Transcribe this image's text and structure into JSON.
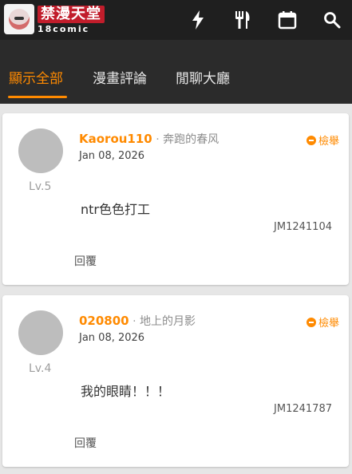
{
  "app": {
    "logo_title": "禁漫天堂",
    "logo_sub": "18comic",
    "icons": [
      "lightning-icon",
      "fork-knife-icon",
      "calendar-icon",
      "search-icon"
    ]
  },
  "tabs": [
    {
      "label": "顯示全部",
      "active": true
    },
    {
      "label": "漫畫評論",
      "active": false
    },
    {
      "label": "閒聊大廳",
      "active": false
    }
  ],
  "colors": {
    "accent": "#ff8a00",
    "topbar": "#1f1f1f",
    "tabbar": "#2b2b2b"
  },
  "comments": [
    {
      "username": "Kaorou110",
      "separator": "·",
      "subname": "奔跑的春风",
      "date": "Jan 08, 2026",
      "level": "Lv.5",
      "report_label": "檢舉",
      "text": "ntr色色打工",
      "comic_id": "JM1241104",
      "reply_label": "回覆"
    },
    {
      "username": "020800",
      "separator": "·",
      "subname": "地上的月影",
      "date": "Jan 08, 2026",
      "level": "Lv.4",
      "report_label": "檢舉",
      "text": "我的眼睛！！！",
      "comic_id": "JM1241787",
      "reply_label": "回覆"
    }
  ]
}
